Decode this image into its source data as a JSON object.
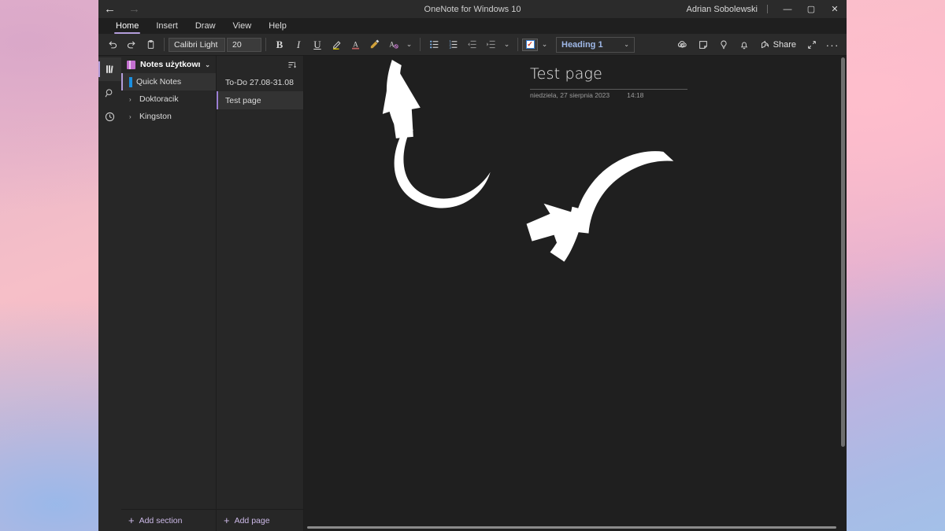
{
  "titlebar": {
    "back_label": "←",
    "forward_label": "→",
    "app_title": "OneNote for Windows 10",
    "account_name": "Adrian Sobolewski",
    "minimize_label": "—",
    "maximize_label": "▢",
    "close_label": "✕"
  },
  "menu": {
    "tabs": [
      {
        "label": "Home",
        "active": true
      },
      {
        "label": "Insert",
        "active": false
      },
      {
        "label": "Draw",
        "active": false
      },
      {
        "label": "View",
        "active": false
      },
      {
        "label": "Help",
        "active": false
      }
    ]
  },
  "ribbon": {
    "undo": "undo-icon",
    "redo": "redo-icon",
    "clipboard": "clipboard-icon",
    "font_name": "Calibri Light",
    "font_size": "20",
    "bold": "B",
    "italic": "I",
    "underline": "U",
    "highlight": "highlighter-icon",
    "font_color": "A",
    "format_painter": "format-painter-icon",
    "clear_formatting": "clear-formatting-icon",
    "font_more": "⌄",
    "bullets": "bulleted-list-icon",
    "numbering": "numbered-list-icon",
    "decrease_indent": "decrease-indent-icon",
    "increase_indent": "increase-indent-icon",
    "paragraph_more": "⌄",
    "todo_tag": "todo-checkbox-icon",
    "todo_check_glyph": "✓",
    "tag_more": "⌄",
    "style_label": "Heading 1",
    "style_chevron": "⌄",
    "sync_icon": "sync-cloud-icon",
    "sticky_note_icon": "sticky-note-icon",
    "ideas_icon": "lightbulb-icon",
    "notifications_icon": "bell-icon",
    "share_label": "Share",
    "expand_icon": "expand-arrows-icon",
    "more_icon": "more-options-icon"
  },
  "rail": {
    "notebooks": "notebooks-icon",
    "search": "search-icon",
    "recent": "recent-clock-icon"
  },
  "notebook": {
    "name": "Notes użytkownika Adrian",
    "chevron": "⌄",
    "sort_icon": "sort-icon",
    "sections": [
      {
        "label": "Quick Notes",
        "selected": true,
        "has_chevron": false,
        "color": "#1a8fe0"
      },
      {
        "label": "Doktoracik",
        "selected": false,
        "has_chevron": true,
        "chevron": "›"
      },
      {
        "label": "Kingston",
        "selected": false,
        "has_chevron": true,
        "chevron": "›"
      }
    ],
    "add_section_label": "Add section",
    "add_section_plus": "+"
  },
  "pages": {
    "items": [
      {
        "label": "To-Do 27.08-31.08",
        "selected": false
      },
      {
        "label": "Test page",
        "selected": true
      }
    ],
    "add_page_label": "Add page",
    "add_page_plus": "+"
  },
  "canvas": {
    "page_title": "Test page",
    "date": "niedziela, 27 sierpnia 2023",
    "time": "14:18"
  },
  "colors": {
    "accent_purple": "#b39ddb",
    "section_blue": "#1a8fe0",
    "notebook_magenta": "#c36fd0",
    "style_blue": "#9fb8e8",
    "window_bg": "#1f1f1f",
    "panel_bg": "#272727"
  }
}
